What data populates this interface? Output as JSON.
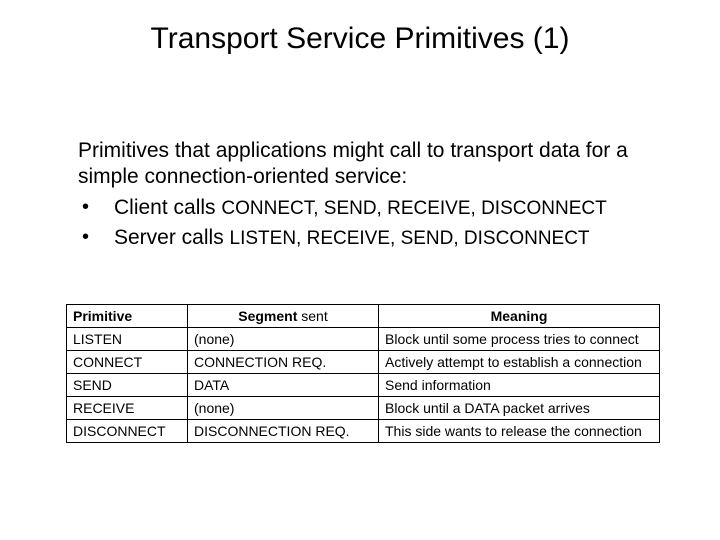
{
  "title": "Transport Service Primitives (1)",
  "intro": "Primitives that applications might call to transport data for a simple connection-oriented service:",
  "bullets": [
    {
      "lead": "Client calls ",
      "prims": "CONNECT, SEND, RECEIVE, DISCONNECT"
    },
    {
      "lead": "Server calls ",
      "prims": "LISTEN, RECEIVE, SEND, DISCONNECT"
    }
  ],
  "table": {
    "headers": {
      "primitive": "Primitive",
      "segment_bold": "Segment",
      "segment_rest": " sent",
      "meaning": "Meaning"
    },
    "rows": [
      {
        "primitive": "LISTEN",
        "segment": "(none)",
        "meaning": "Block until some process tries to connect"
      },
      {
        "primitive": "CONNECT",
        "segment": "CONNECTION REQ.",
        "meaning": "Actively attempt to establish a connection"
      },
      {
        "primitive": "SEND",
        "segment": "DATA",
        "meaning": "Send information"
      },
      {
        "primitive": "RECEIVE",
        "segment": "(none)",
        "meaning": "Block until a DATA packet arrives"
      },
      {
        "primitive": "DISCONNECT",
        "segment": "DISCONNECTION REQ.",
        "meaning": "This side wants to release the connection"
      }
    ]
  }
}
